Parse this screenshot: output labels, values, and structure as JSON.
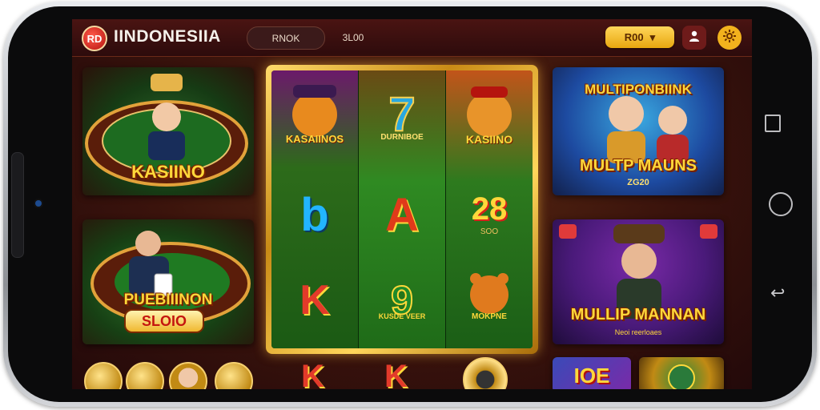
{
  "header": {
    "logo_text": "RD",
    "brand": "IINDONESIIA",
    "pill1": "RNOK",
    "pill2": "3L00",
    "coins_label": "R00",
    "dropdown_glyph": "▾"
  },
  "cards": {
    "kasino": {
      "title": "KASIINO"
    },
    "promo": {
      "title": "PUEBIIINON",
      "badge": "SLOIO"
    },
    "multi_top": {
      "title_top": "MULTIPONBIINK",
      "title_bottom": "MULTP MAUNS",
      "sub": "ZG20"
    },
    "multi_bottom": {
      "title": "MULLIP MANNAN",
      "sub": "Neoi reerloaes"
    }
  },
  "reels": {
    "col1": {
      "top_label": "KASAIINOS",
      "mid": "b",
      "low": "K"
    },
    "col2": {
      "top_label": "DURNIBOE",
      "mid": "A",
      "low_label": "KUSDE VEER"
    },
    "col3": {
      "top_label": "KASIINO",
      "mid": "28",
      "mid_sub": "SOO",
      "low_label": "MOKPNE"
    }
  },
  "bottom_row": {
    "k1": "K",
    "k2": "K",
    "tile": "IOE"
  },
  "colors": {
    "accent": "#f2b21d",
    "brand_red": "#c4150f",
    "felt_green": "#1e7a1e"
  }
}
